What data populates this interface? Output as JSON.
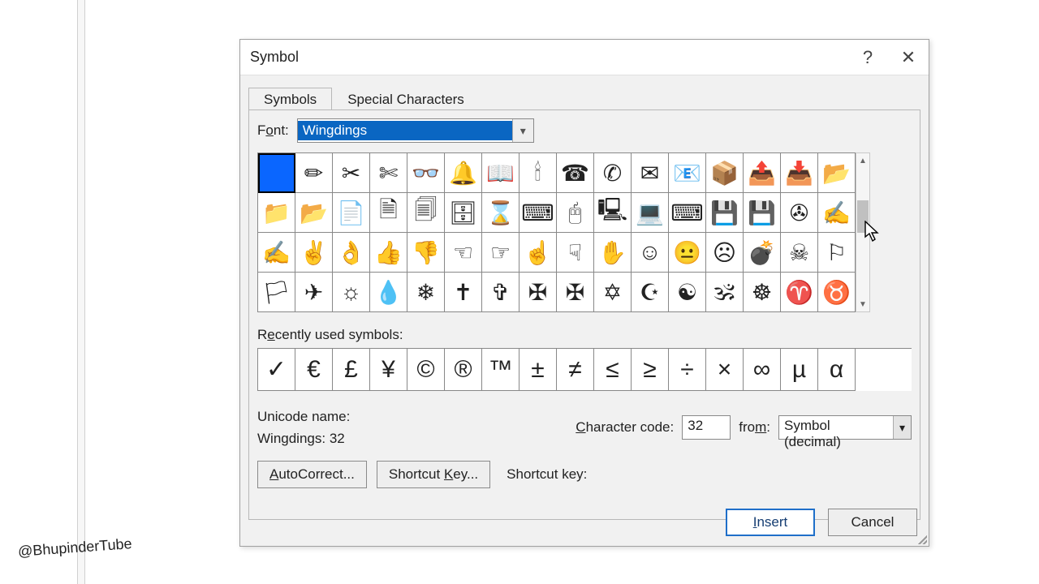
{
  "credit": "@BhupinderTube",
  "dialog": {
    "title": "Symbol",
    "help_tooltip": "?",
    "close_tooltip": "✕",
    "tabs": {
      "symbols": "Symbols",
      "special": "Special Characters"
    },
    "font_label_pre": "F",
    "font_label_u": "o",
    "font_label_post": "nt:",
    "font_value": "Wingdings",
    "grid": [
      [
        "",
        "✏",
        "✂",
        "✄",
        "👓",
        "🔔",
        "📖",
        "🕯",
        "☎",
        "✆",
        "✉",
        "📧",
        "📦",
        "📤",
        "📥",
        "📂"
      ],
      [
        "📁",
        "📂",
        "📄",
        "🗎",
        "🗐",
        "🗄",
        "⌛",
        "⌨",
        "🖰",
        "🖳",
        "💻",
        "⌨",
        "💾",
        "💾",
        "✇",
        "✍"
      ],
      [
        "✍",
        "✌",
        "👌",
        "👍",
        "👎",
        "☜",
        "☞",
        "☝",
        "☟",
        "✋",
        "☺",
        "😐",
        "☹",
        "💣",
        "☠",
        "⚐"
      ],
      [
        "🏳",
        "✈",
        "☼",
        "💧",
        "❄",
        "✝",
        "✞",
        "✠",
        "✠",
        "✡",
        "☪",
        "☯",
        "🕉",
        "☸",
        "♈",
        "♉"
      ]
    ],
    "recent_label_pre": "R",
    "recent_label_u": "e",
    "recent_label_post": "cently used symbols:",
    "recent": [
      "✓",
      "€",
      "£",
      "¥",
      "©",
      "®",
      "™",
      "±",
      "≠",
      "≤",
      "≥",
      "÷",
      "×",
      "∞",
      "µ",
      "α"
    ],
    "unicode_name_label": "Unicode name:",
    "unicode_name_value": "Wingdings: 32",
    "cc_label_pre": "",
    "cc_label_u": "C",
    "cc_label_post": "haracter code:",
    "cc_value": "32",
    "from_label_pre": "fro",
    "from_label_u": "m",
    "from_label_post": ":",
    "from_value": "Symbol (decimal)",
    "autocorrect_pre": "",
    "autocorrect_u": "A",
    "autocorrect_post": "utoCorrect...",
    "shortcutkey_pre": "Shortcut ",
    "shortcutkey_u": "K",
    "shortcutkey_post": "ey...",
    "shortcut_key_label": "Shortcut key:",
    "shortcut_key_value": "",
    "insert_pre": "",
    "insert_u": "I",
    "insert_post": "nsert",
    "cancel": "Cancel"
  }
}
